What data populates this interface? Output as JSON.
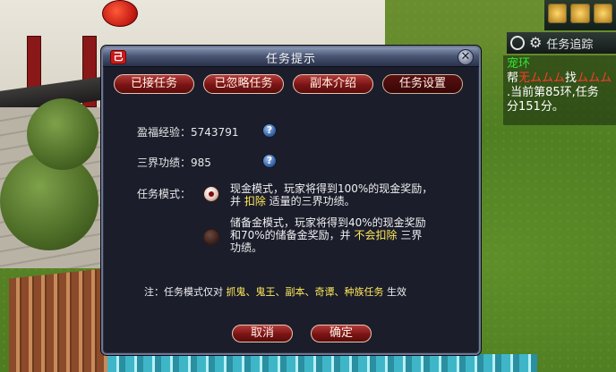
{
  "dialog": {
    "title": "任务提示",
    "logo_glyph": "己",
    "close_glyph": "✕",
    "tabs": [
      {
        "label": "已接任务"
      },
      {
        "label": "已忽略任务"
      },
      {
        "label": "副本介绍"
      },
      {
        "label": "任务设置",
        "active": true
      }
    ],
    "exp": {
      "label": "盈福经验：",
      "value": "5743791"
    },
    "merit": {
      "label": "三界功绩：",
      "value": "985"
    },
    "help_glyph": "?",
    "mode_label": "任务模式：",
    "options": [
      {
        "selected": true,
        "line1": "现金模式，玩家将得到100%的现金奖励，",
        "line2_pre": "并 ",
        "line2_highlight": "扣除",
        "line2_post": " 适量的三界功绩。"
      },
      {
        "selected": false,
        "line1": "储备金模式，玩家将得到40%的现金奖励",
        "line2_pre": "和70%的储备金奖励，并 ",
        "line2_highlight": "不会扣除",
        "line2_post": " 三界",
        "line3": "功绩。"
      }
    ],
    "note": {
      "prefix": "注：任务模式仅对 ",
      "highlight": "抓鬼、鬼王、副本、奇谭、种族任务",
      "suffix": " 生效"
    },
    "cancel_label": "取消",
    "confirm_label": "确定"
  },
  "tracker": {
    "title": "任务追踪",
    "quest_name": "宠环",
    "line1_pre": "帮",
    "line1_red1": "无",
    "line1_mid": "找",
    "line1_red2": "",
    "line2": ".当前第85环,任务",
    "line3": "分151分。"
  },
  "colors": {
    "dialog_bg": "#1b1d2b",
    "button_red": "#7a1414",
    "highlight_yellow": "#ffe95a",
    "quest_green": "#30e830",
    "quest_red": "#ff3a2a"
  }
}
